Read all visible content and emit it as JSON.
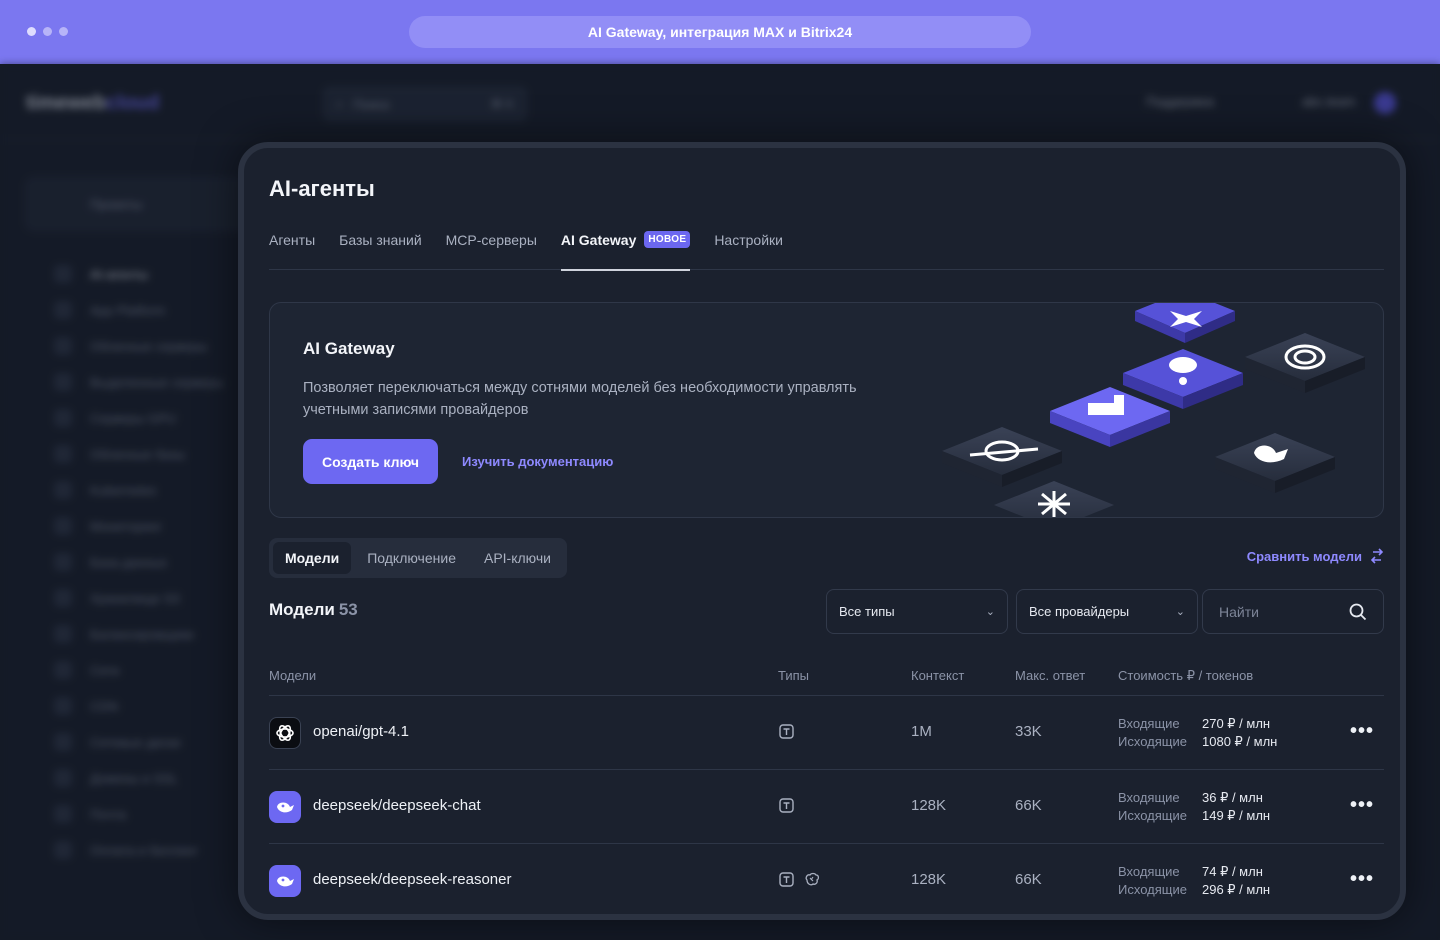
{
  "banner": {
    "url_title": "AI Gateway, интеграция MAX и Bitrix24"
  },
  "bg": {
    "logo_main": "timeweb",
    "logo_accent": "cloud",
    "search_placeholder": "Поиск",
    "search_shortcut": "⌘ K",
    "support": "Поддержка",
    "user": "abc.team",
    "project": "Проекты",
    "menu": [
      "AI-агенты",
      "App Platform",
      "Облачные серверы",
      "Выделенные серверы",
      "Серверы GPU",
      "Облачные базы",
      "Kubernetes",
      "Мониторинг",
      "База данных",
      "Хранилище S3",
      "Балансировщики",
      "Сети",
      "CDN",
      "Сетевые диски",
      "Домены и SSL",
      "Почта",
      "Оплата и биллинг"
    ]
  },
  "page": {
    "title": "AI-агенты",
    "tabs": [
      "Агенты",
      "Базы знаний",
      "MCP-серверы",
      "AI Gateway",
      "Настройки"
    ],
    "active_tab_badge": "НОВОЕ"
  },
  "promo": {
    "title": "AI Gateway",
    "description": "Позволяет переключаться между сотнями моделей без необходимости управлять учетными записями провайдеров",
    "create_button": "Создать ключ",
    "docs_link": "Изучить документацию"
  },
  "subtabs": [
    "Модели",
    "Подключение",
    "API-ключи"
  ],
  "compare_link": "Сравнить модели",
  "models": {
    "heading": "Модели",
    "count": "53",
    "filter_types": "Все типы",
    "filter_providers": "Все провайдеры",
    "search_placeholder": "Найти"
  },
  "table": {
    "headers": [
      "Модели",
      "Типы",
      "Контекст",
      "Макс. ответ",
      "Стоимость ₽ / токенов"
    ],
    "cost_in_label": "Входящие",
    "cost_out_label": "Исходящие",
    "rows": [
      {
        "icon": "openai-icon",
        "name": "openai/gpt-4.1",
        "context": "1M",
        "max_answer": "33K",
        "in": "270 ₽ / млн",
        "out": "1080 ₽ / млн"
      },
      {
        "icon": "deepseek-icon",
        "name": "deepseek/deepseek-chat",
        "context": "128K",
        "max_answer": "66K",
        "in": "36 ₽ / млн",
        "out": "149 ₽ / млн"
      },
      {
        "icon": "deepseek-icon",
        "name": "deepseek/deepseek-reasoner",
        "context": "128K",
        "max_answer": "66K",
        "in": "74 ₽ / млн",
        "out": "296 ₽ / млн"
      }
    ]
  },
  "colors": {
    "accent": "#6d68f2",
    "banner": "#7b77f0",
    "card_bg": "#1b212e"
  }
}
